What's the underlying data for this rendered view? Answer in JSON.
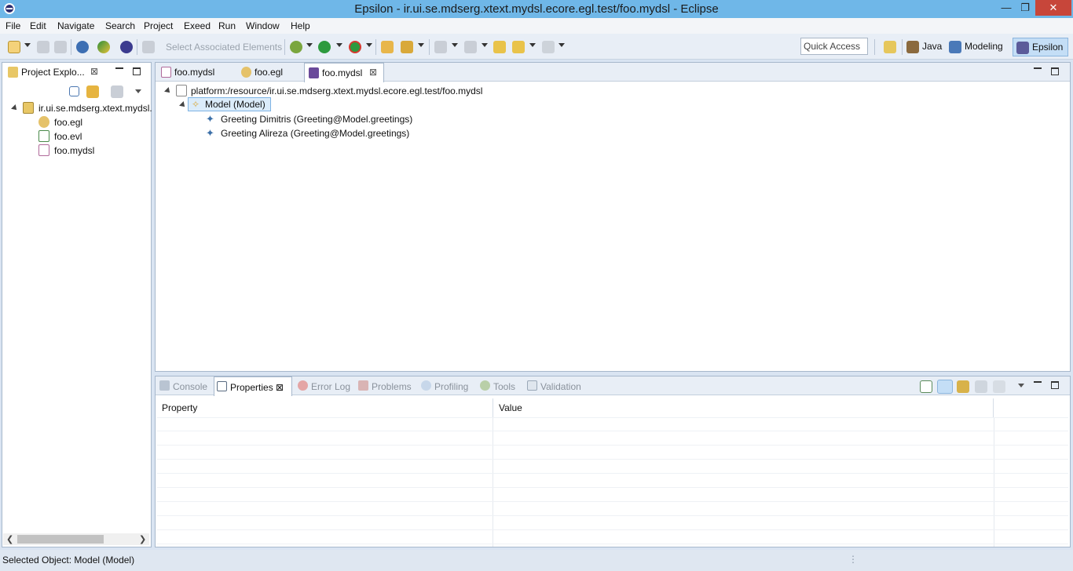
{
  "window": {
    "title": "Epsilon - ir.ui.se.mdserg.xtext.mydsl.ecore.egl.test/foo.mydsl - Eclipse",
    "min_glyph": "—",
    "restore_glyph": "❐",
    "close_glyph": "✕"
  },
  "menu": [
    "File",
    "Edit",
    "Navigate",
    "Search",
    "Project",
    "Exeed",
    "Run",
    "Window",
    "Help"
  ],
  "toolbar": {
    "select_associated": "Select Associated Elements",
    "quick_access": "Quick Access",
    "perspectives": [
      {
        "label": "Java",
        "icon": "java-perspective-icon"
      },
      {
        "label": "Modeling",
        "icon": "modeling-perspective-icon"
      },
      {
        "label": "Epsilon",
        "icon": "epsilon-perspective-icon",
        "active": true
      }
    ]
  },
  "explorer": {
    "tab_label": "Project Explo...",
    "project": "ir.ui.se.mdserg.xtext.mydsl.",
    "files": [
      {
        "name": "foo.egl",
        "icon": "egl-file-icon"
      },
      {
        "name": "foo.evl",
        "icon": "evl-file-icon"
      },
      {
        "name": "foo.mydsl",
        "icon": "mydsl-file-icon"
      }
    ],
    "scroll_left": "❮",
    "scroll_right": "❯"
  },
  "editor": {
    "tabs": [
      {
        "label": "foo.mydsl",
        "active": false
      },
      {
        "label": "foo.egl",
        "active": false
      },
      {
        "label": "foo.mydsl",
        "active": true
      }
    ],
    "resource": "platform:/resource/ir.ui.se.mdserg.xtext.mydsl.ecore.egl.test/foo.mydsl",
    "model_node": "Model (Model)",
    "children": [
      "Greeting Dimitris (Greeting@Model.greetings)",
      "Greeting Alireza (Greeting@Model.greetings)"
    ]
  },
  "bottom_panel": {
    "tabs": [
      "Console",
      "Properties",
      "Error Log",
      "Problems",
      "Profiling",
      "Tools",
      "Validation"
    ],
    "active_tab": "Properties",
    "columns": [
      "Property",
      "Value"
    ]
  },
  "status": {
    "text": "Selected Object: Model (Model)"
  },
  "colors": {
    "titlebar": "#6fb7e8",
    "selection": "#dbecfa",
    "close_button": "#c7463a"
  }
}
